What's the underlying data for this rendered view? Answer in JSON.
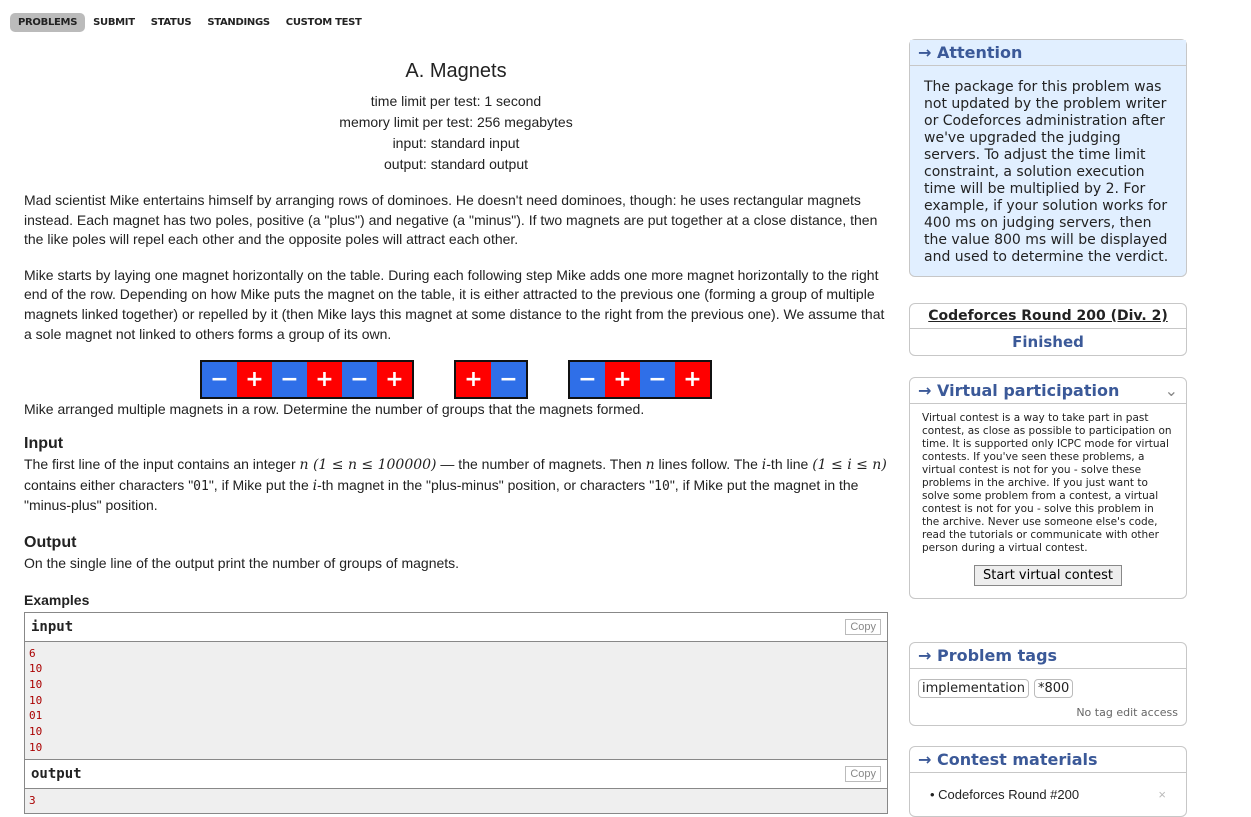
{
  "nav": [
    "PROBLEMS",
    "SUBMIT",
    "STATUS",
    "STANDINGS",
    "CUSTOM TEST"
  ],
  "problem": {
    "title": "A. Magnets",
    "time_limit": "time limit per test: 1 second",
    "memory_limit": "memory limit per test: 256 megabytes",
    "input": "input: standard input",
    "output": "output: standard output",
    "para1": "Mad scientist Mike entertains himself by arranging rows of dominoes. He doesn't need dominoes, though: he uses rectangular magnets instead. Each magnet has two poles, positive (a \"plus\") and negative (a \"minus\"). If two magnets are put together at a close distance, then the like poles will repel each other and the opposite poles will attract each other.",
    "para2": "Mike starts by laying one magnet horizontally on the table. During each following step Mike adds one more magnet horizontally to the right end of the row. Depending on how Mike puts the magnet on the table, it is either attracted to the previous one (forming a group of multiple magnets linked together) or repelled by it (then Mike lays this magnet at some distance to the right from the previous one). We assume that a sole magnet not linked to others forms a group of its own.",
    "caption": "Mike arranged multiple magnets in a row. Determine the number of groups that the magnets formed.",
    "input_title": "Input",
    "input_text_1": "The first line of the input contains an integer ",
    "input_math_1": "n (1 ≤ n ≤ 100000)",
    "input_text_2": " — the number of magnets. Then ",
    "input_math_2": "n",
    "input_text_3": " lines follow. The ",
    "input_math_3": "i",
    "input_text_4": "-th line ",
    "input_math_4": "(1 ≤ i ≤ n)",
    "input_text_5": " contains either characters \"",
    "input_code_1": "01",
    "input_text_6": "\", if Mike put the ",
    "input_math_5": "i",
    "input_text_7": "-th magnet in the \"plus-minus\" position, or characters \"",
    "input_code_2": "10",
    "input_text_8": "\", if Mike put the magnet in the \"minus-plus\" position.",
    "output_title": "Output",
    "output_text": "On the single line of the output print the number of groups of magnets.",
    "examples_title": "Examples",
    "input_label": "input",
    "output_label": "output",
    "copy_label": "Copy",
    "input_lines": [
      "6",
      "10",
      "10",
      "10",
      "01",
      "10",
      "10"
    ],
    "output_lines": [
      "3"
    ]
  },
  "magnet_groups": [
    [
      "−",
      "+",
      "−",
      "+",
      "−",
      "+"
    ],
    [
      "+",
      "−"
    ],
    [
      "−",
      "+",
      "−",
      "+"
    ]
  ],
  "sidebar": {
    "attention_title": "→ Attention",
    "attention_text": "The package for this problem was not updated by the problem writer or Codeforces administration after we've upgraded the judging servers. To adjust the time limit constraint, a solution execution time will be multiplied by 2. For example, if your solution works for 400 ms on judging servers, then the value 800 ms will be displayed and used to determine the verdict.",
    "round_title": "Codeforces Round 200 (Div. 2)",
    "round_status": "Finished",
    "virtual_title": "→ Virtual participation",
    "virtual_text": "Virtual contest is a way to take part in past contest, as close as possible to participation on time. It is supported only ICPC mode for virtual contests. If you've seen these problems, a virtual contest is not for you - solve these problems in the archive. If you just want to solve some problem from a contest, a virtual contest is not for you - solve this problem in the archive. Never use someone else's code, read the tutorials or communicate with other person during a virtual contest.",
    "virtual_button": "Start virtual contest",
    "tags_title": "→ Problem tags",
    "tags": [
      "implementation",
      "*800"
    ],
    "no_tag_edit": "No tag edit access",
    "materials_title": "→ Contest materials",
    "materials": [
      "Codeforces Round #200"
    ]
  },
  "colors": {
    "minus": "#2f6fe8",
    "plus": "#ff0000",
    "sidebar_title": "#3b5998",
    "attention_bg": "#e1efff"
  }
}
